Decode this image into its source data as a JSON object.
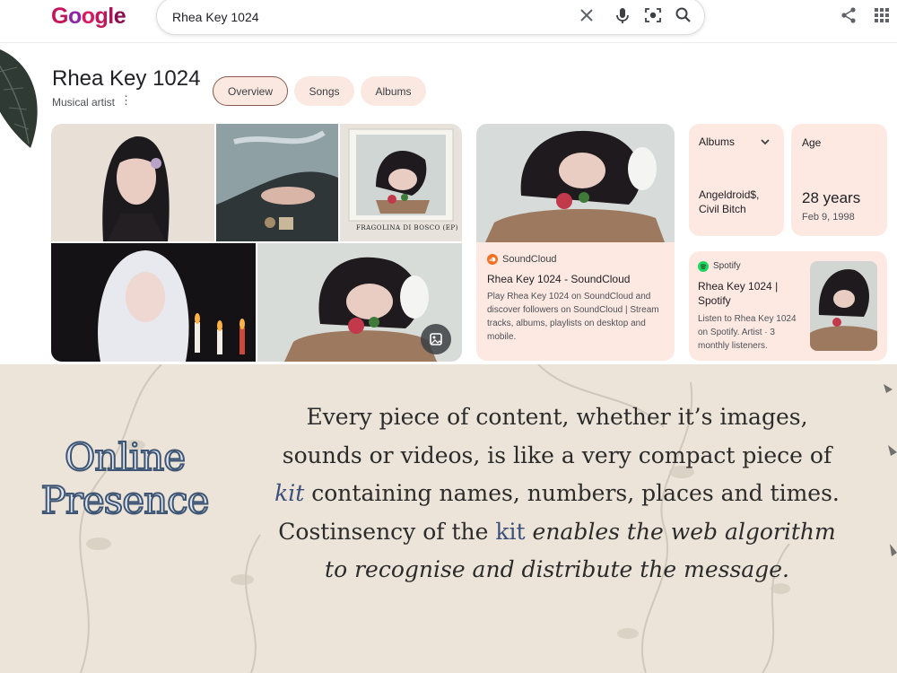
{
  "search": {
    "query": "Rhea Key 1024"
  },
  "logo": {
    "text": "Google"
  },
  "knowledge_panel": {
    "title": "Rhea Key 1024",
    "subtitle": "Musical artist",
    "tabs": [
      {
        "label": "Overview",
        "active": true
      },
      {
        "label": "Songs",
        "active": false
      },
      {
        "label": "Albums",
        "active": false
      }
    ]
  },
  "soundcloud": {
    "source": "SoundCloud",
    "title": "Rhea Key 1024 - SoundCloud",
    "description": "Play Rhea Key 1024 on SoundCloud and discover followers on SoundCloud | Stream tracks, albums, playlists on desktop and mobile."
  },
  "albums_card": {
    "label": "Albums",
    "value": "Angeldroid$, Civil Bitch"
  },
  "age_card": {
    "label": "Age",
    "value": "28 years",
    "date": "Feb 9, 1998"
  },
  "spotify": {
    "source": "Spotify",
    "title": "Rhea Key 1024 | Spotify",
    "description": "Listen to Rhea Key 1024 on Spotify. Artist · 3 monthly listeners."
  },
  "photo_caption": "FRAGOLINA DI BOSCO (EP)",
  "caption": {
    "heading_line1": "Online",
    "heading_line2": "Presence",
    "p1": "Every piece of content, whether it’s images, sounds or videos, is like a very compact piece of ",
    "kit1": "kit",
    "p2": " containing names, numbers, places and times. Costinsency of the ",
    "kit2": "kit",
    "p3": " enables the web algorithm to recognise and distribute the message."
  },
  "colors": {
    "chip_bg": "#fbe8e1",
    "card_bg": "#fde9e2",
    "soundcloud": "#f26f23",
    "spotify": "#1ed760",
    "heading": "#3e5673",
    "kit": "#3b4f7a"
  },
  "icons": [
    "clear-icon",
    "mic-icon",
    "lens-icon",
    "search-icon",
    "share-icon",
    "apps-icon",
    "more-vert-icon",
    "chevron-down-icon",
    "image-search-icon",
    "soundcloud-icon",
    "spotify-icon"
  ]
}
